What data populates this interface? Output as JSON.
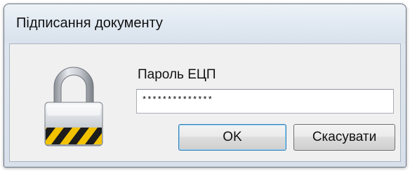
{
  "window": {
    "title": "Підписання документу"
  },
  "form": {
    "password_label": "Пароль ЕЦП",
    "password_value": "**************"
  },
  "buttons": {
    "ok_label": "OK",
    "cancel_label": "Скасувати"
  },
  "icons": {
    "lock": "padlock-icon"
  }
}
